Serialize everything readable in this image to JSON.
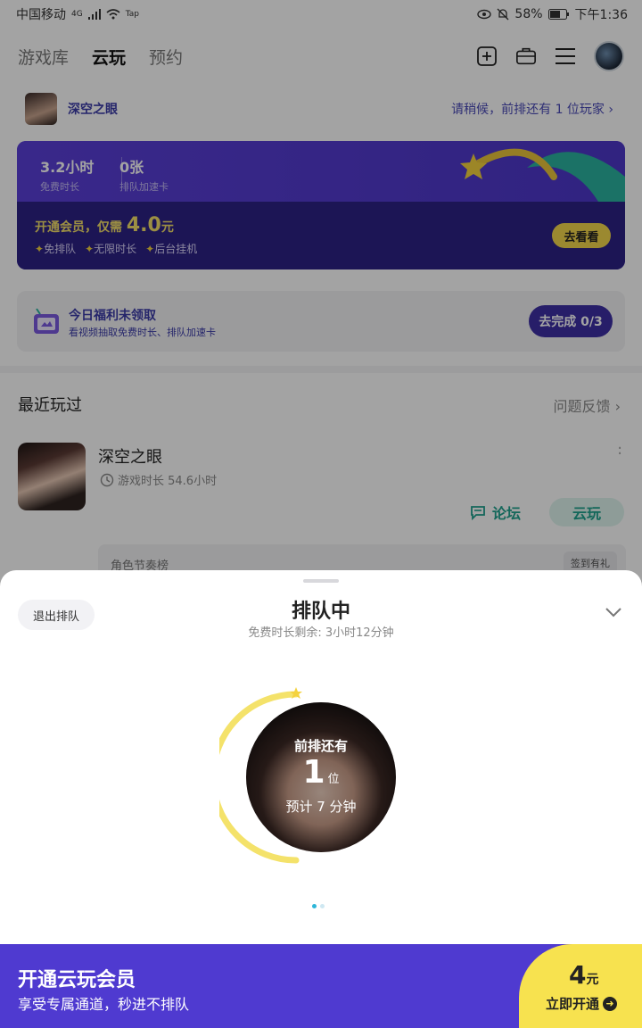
{
  "status_bar": {
    "carrier": "中国移动",
    "network": "4G",
    "wifi_tag": "Tap",
    "battery": "58%",
    "time": "下午1:36"
  },
  "nav": {
    "tabs": [
      {
        "label": "游戏库"
      },
      {
        "label": "云玩"
      },
      {
        "label": "预约"
      }
    ],
    "active_tab": "云玩"
  },
  "queue_row": {
    "game": "深空之眼",
    "status": "请稍候，前排还有 1 位玩家"
  },
  "banner": {
    "free_hours": "3.2小时",
    "free_hours_label": "免费时长",
    "cards": "0张",
    "cards_label": "排队加速卡",
    "title_prefix": "开通会员，仅需",
    "price": "4.0",
    "price_unit": "元",
    "perks": [
      "免排队",
      "无限时长",
      "后台挂机"
    ],
    "cta": "去看看"
  },
  "welfare": {
    "title": "今日福利未领取",
    "subtitle": "看视频抽取免费时长、排队加速卡",
    "cta": "去完成 0/3"
  },
  "recent": {
    "title": "最近玩过",
    "feedback": "问题反馈",
    "game_name": "深空之眼",
    "play_time": "游戏时长 54.6小时",
    "forum": "论坛",
    "cloud_play": "云玩",
    "sub_left": "角色节奏榜",
    "sub_right": "签到有礼"
  },
  "sheet": {
    "exit": "退出排队",
    "title": "排队中",
    "subtitle": "免费时长剩余: 3小时12分钟",
    "ahead_label": "前排还有",
    "ahead_count": "1",
    "ahead_unit": "位",
    "eta": "预计 7 分钟"
  },
  "footer": {
    "title": "开通云玩会员",
    "subtitle": "享受专属通道，秒进不排队",
    "price": "4",
    "price_unit": "元",
    "cta": "立即开通"
  },
  "colors": {
    "brand_purple": "#4f3ad0",
    "accent_yellow": "#f7e24f",
    "accent_teal": "#1fa18e"
  }
}
